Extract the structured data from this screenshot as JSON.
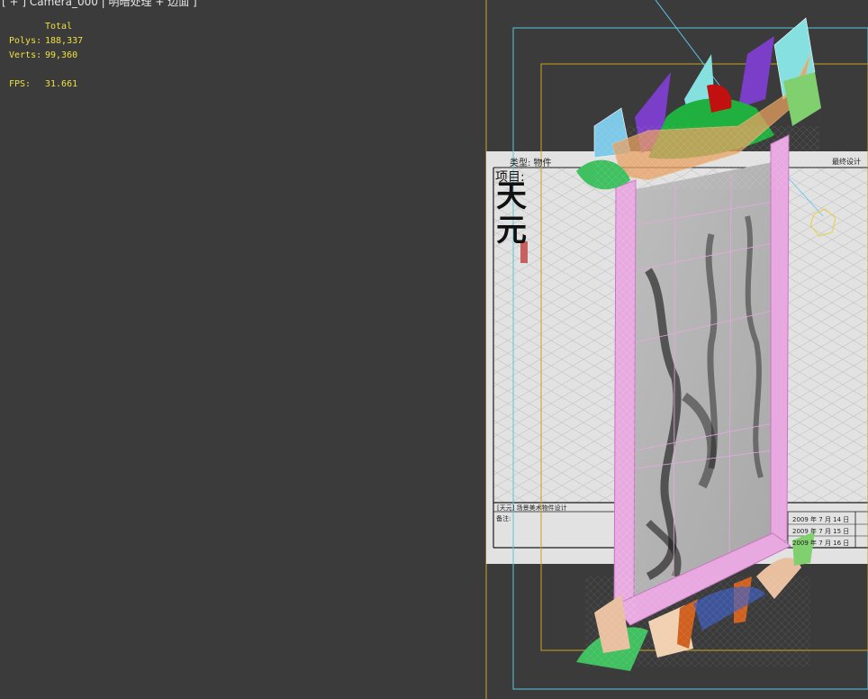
{
  "viewport": {
    "label": "[ + ] Camera_000 | 明暗处理 + 边面 ]",
    "stats": {
      "header": "Total",
      "polys_label": "Polys:",
      "polys_value": "188,337",
      "verts_label": "Verts:",
      "verts_value": "99,360",
      "fps_label": "FPS:",
      "fps_value": "31.661"
    }
  },
  "reference_sheet": {
    "type_label": "类型: 物件",
    "project_label": "项目:",
    "calligraphy_top": "天",
    "calligraphy_bottom": "元",
    "top_right_note": "最终设计",
    "footer_note_label": "备注:",
    "footer_title": "[天元] 场景美术物件设计",
    "date_rows": [
      "2009 年  7 月 14 日",
      "2009 年  7 月 15 日",
      "2009 年  7 月 16 日"
    ]
  },
  "colors": {
    "viewport_bg": "#3b3b3b",
    "safe_frame_outer": "#55c8e0",
    "safe_frame_inner": "#c8a020",
    "stats_text": "#f0e040",
    "frame_pink": "#e8a8e0",
    "camera_line": "#5ac8e8"
  }
}
